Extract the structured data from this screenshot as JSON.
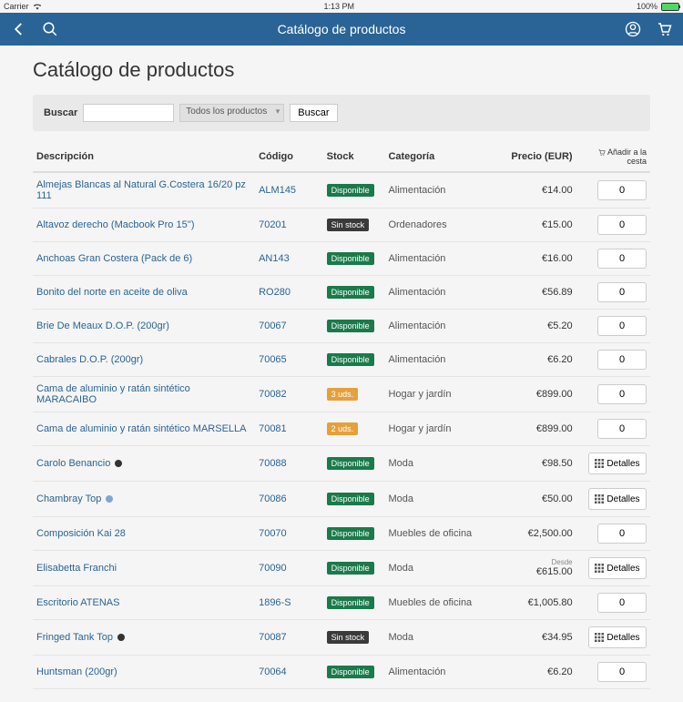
{
  "status": {
    "carrier": "Carrier",
    "time": "1:13 PM",
    "battery": "100%"
  },
  "nav": {
    "title": "Catálogo de productos"
  },
  "page": {
    "title": "Catálogo de productos"
  },
  "search": {
    "label": "Buscar",
    "filter": "Todos los productos",
    "button": "Buscar"
  },
  "columns": {
    "desc": "Descripción",
    "code": "Código",
    "stock": "Stock",
    "category": "Categoría",
    "price": "Precio (EUR)",
    "add": "Añadir a la cesta"
  },
  "stock_labels": {
    "available": "Disponible",
    "out": "Sin stock",
    "uds3": "3 uds.",
    "uds2": "2 uds."
  },
  "btn": {
    "details": "Detalles"
  },
  "desde": "Desde",
  "rows": [
    {
      "desc": "Almejas Blancas al Natural G.Costera 16/20 pz 111",
      "code": "ALM145",
      "stock": "available",
      "cat": "Alimentación",
      "price": "€14.00",
      "action": "qty",
      "qty": "0"
    },
    {
      "desc": "Altavoz derecho (Macbook Pro 15'')",
      "code": "70201",
      "stock": "out",
      "cat": "Ordenadores",
      "price": "€15.00",
      "action": "qty",
      "qty": "0"
    },
    {
      "desc": "Anchoas Gran Costera (Pack de 6)",
      "code": "AN143",
      "stock": "available",
      "cat": "Alimentación",
      "price": "€16.00",
      "action": "qty",
      "qty": "0"
    },
    {
      "desc": "Bonito del norte en aceite de oliva",
      "code": "RO280",
      "stock": "available",
      "cat": "Alimentación",
      "price": "€56.89",
      "action": "qty",
      "qty": "0"
    },
    {
      "desc": "Brie De Meaux D.O.P. (200gr)",
      "code": "70067",
      "stock": "available",
      "cat": "Alimentación",
      "price": "€5.20",
      "action": "qty",
      "qty": "0"
    },
    {
      "desc": "Cabrales D.O.P. (200gr)",
      "code": "70065",
      "stock": "available",
      "cat": "Alimentación",
      "price": "€6.20",
      "action": "qty",
      "qty": "0"
    },
    {
      "desc": "Cama de aluminio y ratán sintético MARACAIBO",
      "code": "70082",
      "stock": "uds3",
      "cat": "Hogar y jardín",
      "price": "€899.00",
      "action": "qty",
      "qty": "0"
    },
    {
      "desc": "Cama de aluminio y ratán sintético MARSELLA",
      "code": "70081",
      "stock": "uds2",
      "cat": "Hogar y jardín",
      "price": "€899.00",
      "action": "qty",
      "qty": "0"
    },
    {
      "desc": "Carolo Benancio",
      "dot": "black",
      "code": "70088",
      "stock": "available",
      "cat": "Moda",
      "price": "€98.50",
      "action": "details"
    },
    {
      "desc": "Chambray Top",
      "dot": "blue",
      "code": "70086",
      "stock": "available",
      "cat": "Moda",
      "price": "€50.00",
      "action": "details"
    },
    {
      "desc": "Composición Kai 28",
      "code": "70070",
      "stock": "available",
      "cat": "Muebles de oficina",
      "price": "€2,500.00",
      "action": "qty",
      "qty": "0"
    },
    {
      "desc": "Elisabetta Franchi",
      "code": "70090",
      "stock": "available",
      "cat": "Moda",
      "price": "€615.00",
      "desde": true,
      "action": "details"
    },
    {
      "desc": "Escritorio ATENAS",
      "code": "1896-S",
      "stock": "available",
      "cat": "Muebles de oficina",
      "price": "€1,005.80",
      "action": "qty",
      "qty": "0"
    },
    {
      "desc": "Fringed Tank Top",
      "dot": "black",
      "code": "70087",
      "stock": "out",
      "cat": "Moda",
      "price": "€34.95",
      "action": "details"
    },
    {
      "desc": "Huntsman (200gr)",
      "code": "70064",
      "stock": "available",
      "cat": "Alimentación",
      "price": "€6.20",
      "action": "qty",
      "qty": "0"
    }
  ]
}
